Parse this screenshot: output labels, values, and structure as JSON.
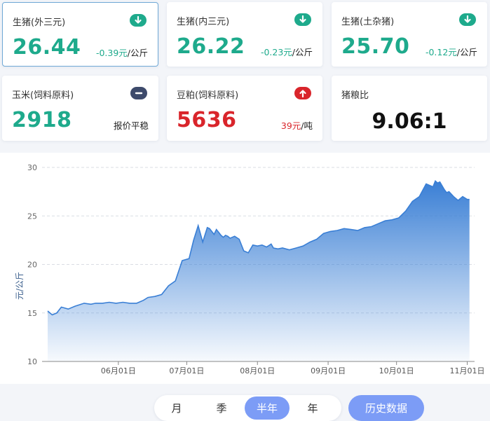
{
  "cards": [
    {
      "title": "生猪(外三元)",
      "value": "26.44",
      "change": "-0.39元",
      "unit": "/公斤",
      "trend": "down",
      "color": "#1eaa8c"
    },
    {
      "title": "生猪(内三元)",
      "value": "26.22",
      "change": "-0.23元",
      "unit": "/公斤",
      "trend": "down",
      "color": "#1eaa8c"
    },
    {
      "title": "生猪(土杂猪)",
      "value": "25.70",
      "change": "-0.12元",
      "unit": "/公斤",
      "trend": "down",
      "color": "#1eaa8c"
    },
    {
      "title": "玉米(饲料原料)",
      "value": "2918",
      "change": "报价平稳",
      "unit": "",
      "trend": "flat",
      "color": "#1eaa8c"
    },
    {
      "title": "豆粕(饲料原料)",
      "value": "5636",
      "change": "39元",
      "unit": "/吨",
      "trend": "up",
      "color": "#d9252b"
    }
  ],
  "ratio": {
    "title": "猪粮比",
    "value": "9.06:1"
  },
  "colors": {
    "down": "#1eaa8c",
    "up": "#d9252b",
    "flat": "#3d4a6b",
    "accent": "#7c9cf6",
    "line": "#3a7fd5"
  },
  "chart_data": {
    "type": "area",
    "ylabel": "元/公斤",
    "ylim": [
      10,
      30
    ],
    "yticks": [
      10,
      15,
      20,
      25,
      30
    ],
    "xticks": [
      "06月01日",
      "07月01日",
      "08月01日",
      "09月01日",
      "10月01日",
      "11月01日"
    ],
    "xtick_days": [
      31,
      61,
      92,
      123,
      153,
      184
    ],
    "xlim_days": [
      0,
      186
    ],
    "days": [
      0,
      2,
      4,
      6,
      9,
      12,
      16,
      19,
      21,
      24,
      27,
      30,
      33,
      36,
      39,
      42,
      44,
      47,
      50,
      53,
      56,
      59,
      62,
      64,
      66,
      68,
      70,
      71,
      73,
      74,
      75,
      76,
      77,
      78,
      79,
      80,
      82,
      84,
      86,
      88,
      90,
      92,
      94,
      96,
      98,
      99,
      101,
      103,
      106,
      109,
      112,
      115,
      118,
      121,
      124,
      127,
      130,
      133,
      136,
      139,
      142,
      145,
      148,
      151,
      154,
      157,
      160,
      163,
      166,
      169,
      170,
      171,
      172,
      173,
      174,
      175,
      176,
      178,
      180,
      182,
      184,
      185
    ],
    "values": [
      15.2,
      14.8,
      15.0,
      15.6,
      15.4,
      15.7,
      16.0,
      15.9,
      16.0,
      16.0,
      16.1,
      16.0,
      16.1,
      16.0,
      16.0,
      16.3,
      16.6,
      16.7,
      16.9,
      17.8,
      18.3,
      20.4,
      20.6,
      22.5,
      24.0,
      22.3,
      23.8,
      23.7,
      23.1,
      23.6,
      23.3,
      23.0,
      22.8,
      23.0,
      22.9,
      22.7,
      22.9,
      22.6,
      21.4,
      21.2,
      22.0,
      21.9,
      22.0,
      21.8,
      22.1,
      21.7,
      21.6,
      21.7,
      21.5,
      21.7,
      21.9,
      22.3,
      22.6,
      23.2,
      23.4,
      23.5,
      23.7,
      23.6,
      23.5,
      23.8,
      23.9,
      24.2,
      24.5,
      24.6,
      24.8,
      25.5,
      26.5,
      27.0,
      28.3,
      28.0,
      28.6,
      28.4,
      28.5,
      28.1,
      27.7,
      27.4,
      27.5,
      27.0,
      26.6,
      27.0,
      26.7,
      26.7
    ]
  },
  "controls": {
    "tabs": [
      "月",
      "季",
      "半年",
      "年"
    ],
    "active_index": 2,
    "history_label": "历史数据"
  }
}
